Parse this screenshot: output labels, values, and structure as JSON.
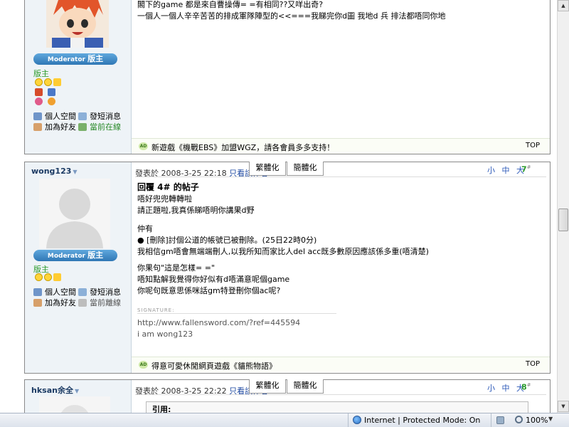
{
  "posts": [
    {
      "rank": "版主",
      "mod_label": "Moderator",
      "mod_big": "版主",
      "body_lines": [
        "閣下的game 都是來自曹操傳= =有相同??又咩出奇?",
        "一個人一個人辛辛苦苦的排成軍隊陣型的<<===我睇完你d圖 我地d 兵 排法都唔同你地"
      ],
      "actions": {
        "profile": "個人空間",
        "message": "發短消息",
        "add_friend": "加為好友",
        "status": "當前在線"
      },
      "ad_text": "新遊戲《機戰EBS》加盟WGZ，請各會員多多支持！",
      "top_label": "TOP"
    },
    {
      "username": "wong123",
      "posted_prefix": "發表於",
      "date": "2008-3-25 22:18",
      "author_only": "只看該作者",
      "tab_trad": "繁體化",
      "tab_simp": "簡體化",
      "size_links": "小 中 大",
      "floor_num": "7",
      "floor_sup": "#",
      "mod_label": "Moderator",
      "mod_big": "版主",
      "rank": "版主",
      "actions": {
        "profile": "個人空間",
        "message": "發短消息",
        "add_friend": "加為好友",
        "status": "當前離線"
      },
      "title": "回覆 4# 的帖子",
      "body1": [
        "唔好兜兜轉轉啦",
        "請正題啦,我真係睇唔明你講果d野"
      ],
      "body2": [
        "仲有",
        "● [刪除]討個公道的帳號已被刪除。(25日22時0分)",
        "我相信gm唔會無端端刪人,以我所知而家比人del acc既多數原因應該係多重(唔清楚)"
      ],
      "body3": [
        "你果句\"這是怎樣= =\"",
        "唔知點解我覺得你好似有d唔滿意呢個game",
        "你呢句既意思係咪話gm特登刪你個ac呢?"
      ],
      "sig_label": "SIGNATURE:",
      "sig_lines": [
        "http://www.fallensword.com/?ref=445594",
        "i am wong123"
      ],
      "ad_text": "得意可愛休閒網頁遊戲《貓熊物語》",
      "top_label": "TOP"
    },
    {
      "username": "hksan余全",
      "posted_prefix": "發表於",
      "date": "2008-3-25 22:22",
      "author_only": "只看該作者",
      "tab_trad": "繁體化",
      "tab_simp": "簡體化",
      "size_links": "小 中 大",
      "floor_num": "8",
      "floor_sup": "#",
      "quote_label": "引用:"
    }
  ],
  "status_bar": {
    "zone": "Internet | Protected Mode: On",
    "zoom": "100%"
  }
}
